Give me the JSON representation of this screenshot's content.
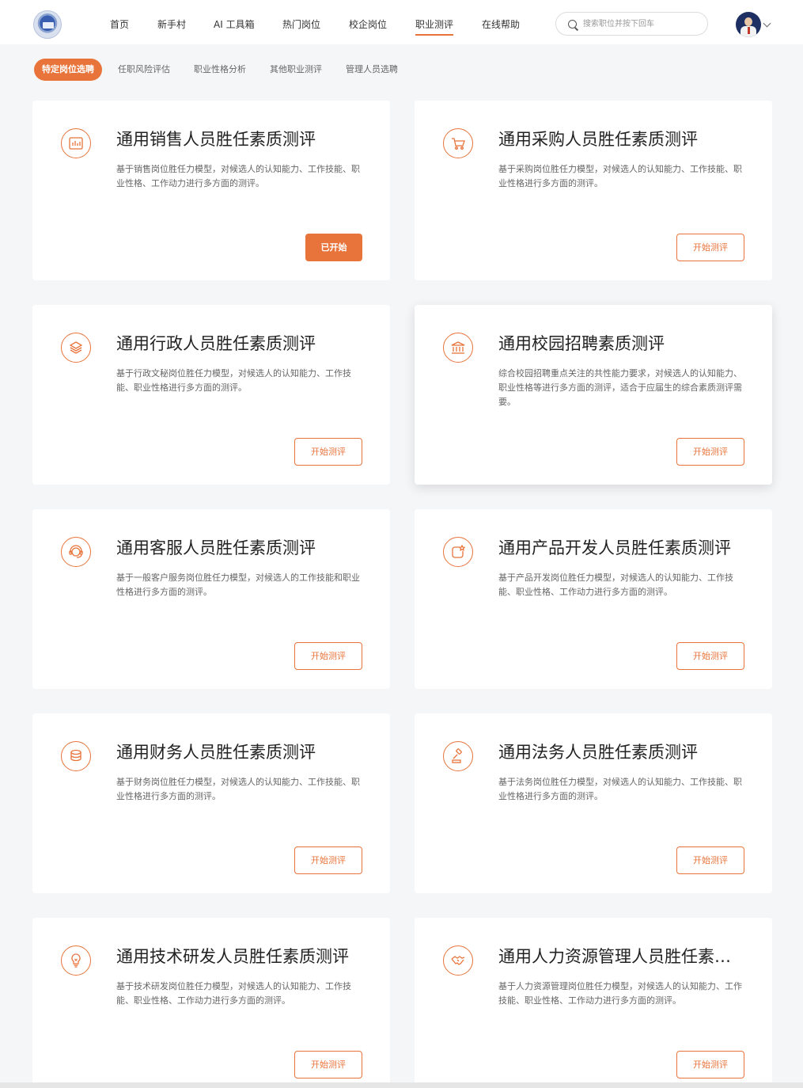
{
  "header": {
    "nav": [
      {
        "label": "首页"
      },
      {
        "label": "新手村"
      },
      {
        "label": "AI 工具箱"
      },
      {
        "label": "热门岗位"
      },
      {
        "label": "校企岗位"
      },
      {
        "label": "职业测评",
        "active": true
      },
      {
        "label": "在线帮助"
      }
    ],
    "search_placeholder": "搜索职位并按下回车"
  },
  "tabs": [
    {
      "label": "特定岗位选聘",
      "active": true
    },
    {
      "label": "任职风险评估"
    },
    {
      "label": "职业性格分析"
    },
    {
      "label": "其他职业测评"
    },
    {
      "label": "管理人员选聘"
    }
  ],
  "accent_color": "#e8743b",
  "cards": [
    {
      "icon": "bar-chart-icon",
      "title": "通用销售人员胜任素质测评",
      "desc": "基于销售岗位胜任力模型，对候选人的认知能力、工作技能、职业性格、工作动力进行多方面的测评。",
      "button": "已开始",
      "started": true
    },
    {
      "icon": "shopping-cart-icon",
      "title": "通用采购人员胜任素质测评",
      "desc": "基于采购岗位胜任力模型，对候选人的认知能力、工作技能、职业性格进行多方面的测评。",
      "button": "开始测评"
    },
    {
      "icon": "layers-icon",
      "title": "通用行政人员胜任素质测评",
      "desc": "基于行政文秘岗位胜任力模型，对候选人的认知能力、工作技能、职业性格进行多方面的测评。",
      "button": "开始测评"
    },
    {
      "icon": "bank-icon",
      "title": "通用校园招聘素质测评",
      "desc": "综合校园招聘重点关注的共性能力要求，对候选人的认知能力、职业性格等进行多方面的测评，适合于应届生的综合素质测评需要。",
      "button": "开始测评"
    },
    {
      "icon": "headset-icon",
      "title": "通用客服人员胜任素质测评",
      "desc": "基于一般客户服务岗位胜任力模型，对候选人的工作技能和职业性格进行多方面的测评。",
      "button": "开始测评"
    },
    {
      "icon": "product-icon",
      "title": "通用产品开发人员胜任素质测评",
      "desc": "基于产品开发岗位胜任力模型，对候选人的认知能力、工作技能、职业性格、工作动力进行多方面的测评。",
      "button": "开始测评"
    },
    {
      "icon": "coins-icon",
      "title": "通用财务人员胜任素质测评",
      "desc": "基于财务岗位胜任力模型，对候选人的认知能力、工作技能、职业性格进行多方面的测评。",
      "button": "开始测评"
    },
    {
      "icon": "gavel-icon",
      "title": "通用法务人员胜任素质测评",
      "desc": "基于法务岗位胜任力模型，对候选人的认知能力、工作技能、职业性格进行多方面的测评。",
      "button": "开始测评"
    },
    {
      "icon": "lightbulb-icon",
      "title": "通用技术研发人员胜任素质测评",
      "desc": "基于技术研发岗位胜任力模型，对候选人的认知能力、工作技能、职业性格、工作动力进行多方面的测评。",
      "button": "开始测评"
    },
    {
      "icon": "handshake-icon",
      "title": "通用人力资源管理人员胜任素质测评",
      "desc": "基于人力资源管理岗位胜任力模型，对候选人的认知能力、工作技能、职业性格、工作动力进行多方面的测评。",
      "button": "开始测评"
    }
  ]
}
